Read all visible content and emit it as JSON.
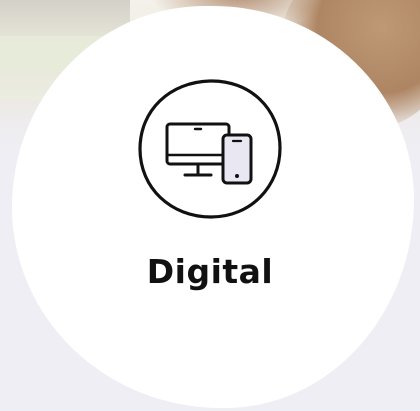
{
  "service": {
    "title": "Digital",
    "icon": "devices-icon"
  },
  "colors": {
    "card": "#ffffff",
    "background": "#efeef4",
    "icon_stroke": "#111111",
    "phone_fill": "#e9e7f2"
  }
}
